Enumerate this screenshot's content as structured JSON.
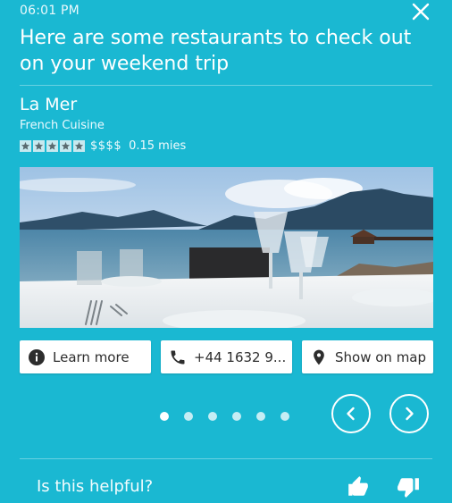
{
  "status_bar": {
    "time": "06:01 PM"
  },
  "header": {
    "headline": "Here are some restaurants to check out on your weekend trip",
    "close_icon": "close-icon"
  },
  "restaurant": {
    "name": "La Mer",
    "cuisine": "French Cuisine",
    "rating_stars": 5,
    "rating_max": 5,
    "price": "$$$$",
    "distance": "0.15 mies"
  },
  "actions": {
    "learn_more": {
      "label": "Learn more",
      "icon": "info-icon"
    },
    "phone": {
      "label": "+44 1632 9...",
      "icon": "phone-icon"
    },
    "map": {
      "label": "Show on map",
      "icon": "map-pin-icon"
    }
  },
  "pager": {
    "total": 6,
    "active_index": 0
  },
  "navigation": {
    "prev_icon": "chevron-left-icon",
    "next_icon": "chevron-right-icon"
  },
  "feedback": {
    "question": "Is this helpful?",
    "up_icon": "thumbs-up-icon",
    "down_icon": "thumbs-down-icon"
  },
  "colors": {
    "background": "#1ab8d2",
    "button_bg": "#ffffff",
    "button_text": "#2d2d2d"
  }
}
